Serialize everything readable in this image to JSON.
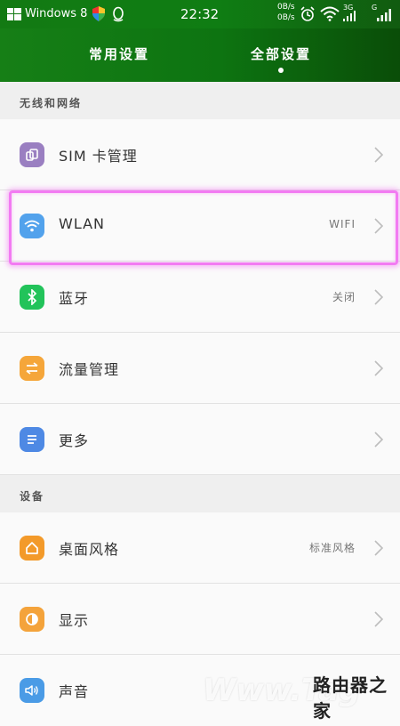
{
  "status_bar": {
    "carrier": "Windows 8",
    "time": "22:32",
    "speed_up": "0B/s",
    "speed_down": "0B/s",
    "net_3g": "3G",
    "net_g": "G"
  },
  "header": {
    "tabs": [
      {
        "label": "常用设置",
        "active": false
      },
      {
        "label": "全部设置",
        "active": true
      }
    ]
  },
  "sections": [
    {
      "title": "无线和网络"
    },
    {
      "title": "设备"
    }
  ],
  "rows": [
    {
      "label": "SIM 卡管理",
      "value": "",
      "icon": "sim-icon",
      "color": "#9a7fc1"
    },
    {
      "label": "WLAN",
      "value": "WIFI",
      "icon": "wifi-icon",
      "color": "#52a2ec"
    },
    {
      "label": "蓝牙",
      "value": "关闭",
      "icon": "bluetooth-icon",
      "color": "#22c35a"
    },
    {
      "label": "流量管理",
      "value": "",
      "icon": "data-usage-icon",
      "color": "#f5a63a"
    },
    {
      "label": "更多",
      "value": "",
      "icon": "more-icon",
      "color": "#4e89e4"
    },
    {
      "label": "桌面风格",
      "value": "标准风格",
      "icon": "home-icon",
      "color": "#f39a2a"
    },
    {
      "label": "显示",
      "value": "",
      "icon": "display-icon",
      "color": "#f4a33b"
    },
    {
      "label": "声音",
      "value": "",
      "icon": "sound-icon",
      "color": "#4a9be6"
    }
  ],
  "watermark": {
    "text": "Www.Tag",
    "brand": "路由器之家"
  }
}
